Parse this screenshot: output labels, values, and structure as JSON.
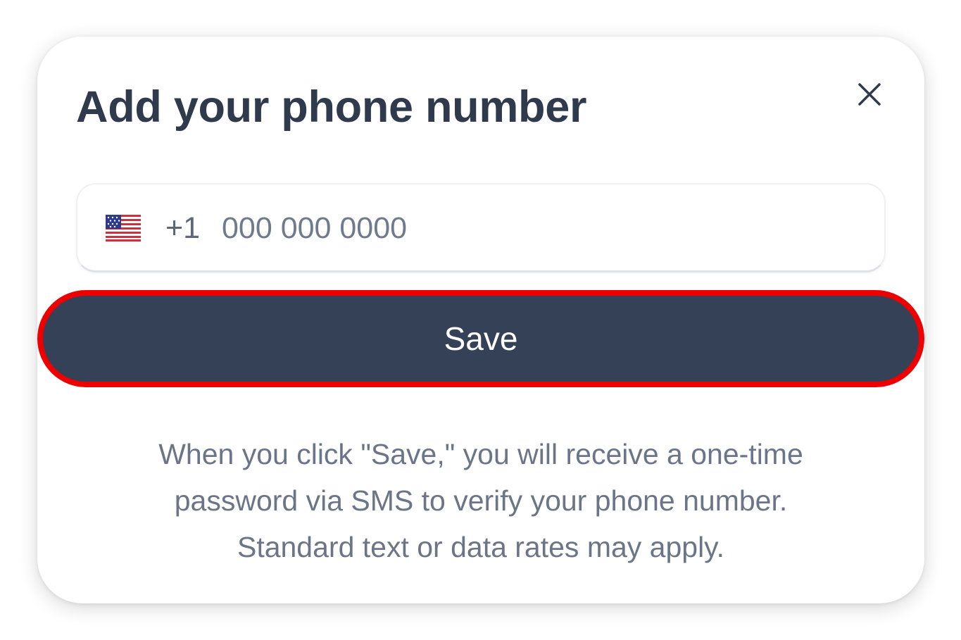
{
  "dialog": {
    "title": "Add your phone number"
  },
  "phone": {
    "country": "United States",
    "flag_icon": "us-flag-icon",
    "dial_code": "+1",
    "value": "",
    "placeholder": "000 000 0000"
  },
  "save_label": "Save",
  "disclaimer": {
    "line1": "When you click \"Save,\" you will receive a one-time",
    "line2": "password via SMS to verify your phone number.",
    "line3": "Standard text or data rates may apply."
  },
  "colors": {
    "title": "#2f3a4c",
    "button_bg": "#354156",
    "highlight_border": "#ee0000",
    "muted_text": "#6b7587"
  }
}
